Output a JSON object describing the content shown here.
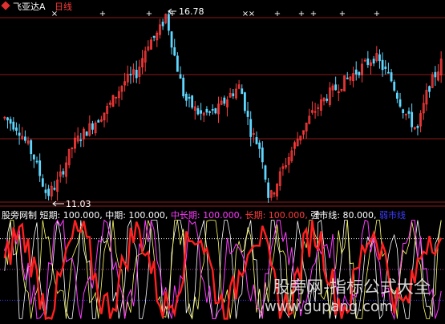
{
  "header": {
    "symbol": "飞亚达A",
    "timeframe": "日线"
  },
  "price_panel": {
    "high_label": "16.78",
    "low_label": "11.03",
    "up_color": "#ff3b3b",
    "down_color": "#5fd7ff",
    "grid_color": "#8b1a1a"
  },
  "indicator_panel": {
    "name": "股旁网制",
    "params": [
      {
        "label": "短期",
        "value": "100.000",
        "color": "#ffffff"
      },
      {
        "label": "中期",
        "value": "100.000",
        "color": "#ffffff"
      },
      {
        "label": "中长期",
        "value": "100.000",
        "color": "#ff3bff"
      },
      {
        "label": "长期",
        "value": "100.000",
        "color": "#ff3b3b"
      },
      {
        "label": "强市线",
        "value": "80.000",
        "color": "#ffffff"
      }
    ],
    "extra_label": "弱市线",
    "extra_color": "#3b3bff"
  },
  "watermark": {
    "text": "股旁网-指标公式大全",
    "url": "www.gupang.com"
  },
  "chart_data": {
    "type": "candlestick",
    "title": "",
    "xlabel": "",
    "ylabel": "",
    "ylim": [
      11.0,
      16.8
    ],
    "price_high": 16.78,
    "price_low": 11.03,
    "top_markers": [
      "×",
      "+",
      "+",
      "+",
      "×",
      "×",
      "+",
      "+",
      "+",
      "+",
      "+"
    ],
    "candles_note": "approx. 150 daily candles",
    "indicator": {
      "ylim": [
        0,
        100
      ],
      "reference_lines": [
        {
          "name": "强市线",
          "value": 80
        },
        {
          "name": "弱市线",
          "value": 20
        }
      ],
      "series": [
        {
          "name": "短期"
        },
        {
          "name": "中期"
        },
        {
          "name": "中长期"
        },
        {
          "name": "长期"
        }
      ]
    }
  }
}
